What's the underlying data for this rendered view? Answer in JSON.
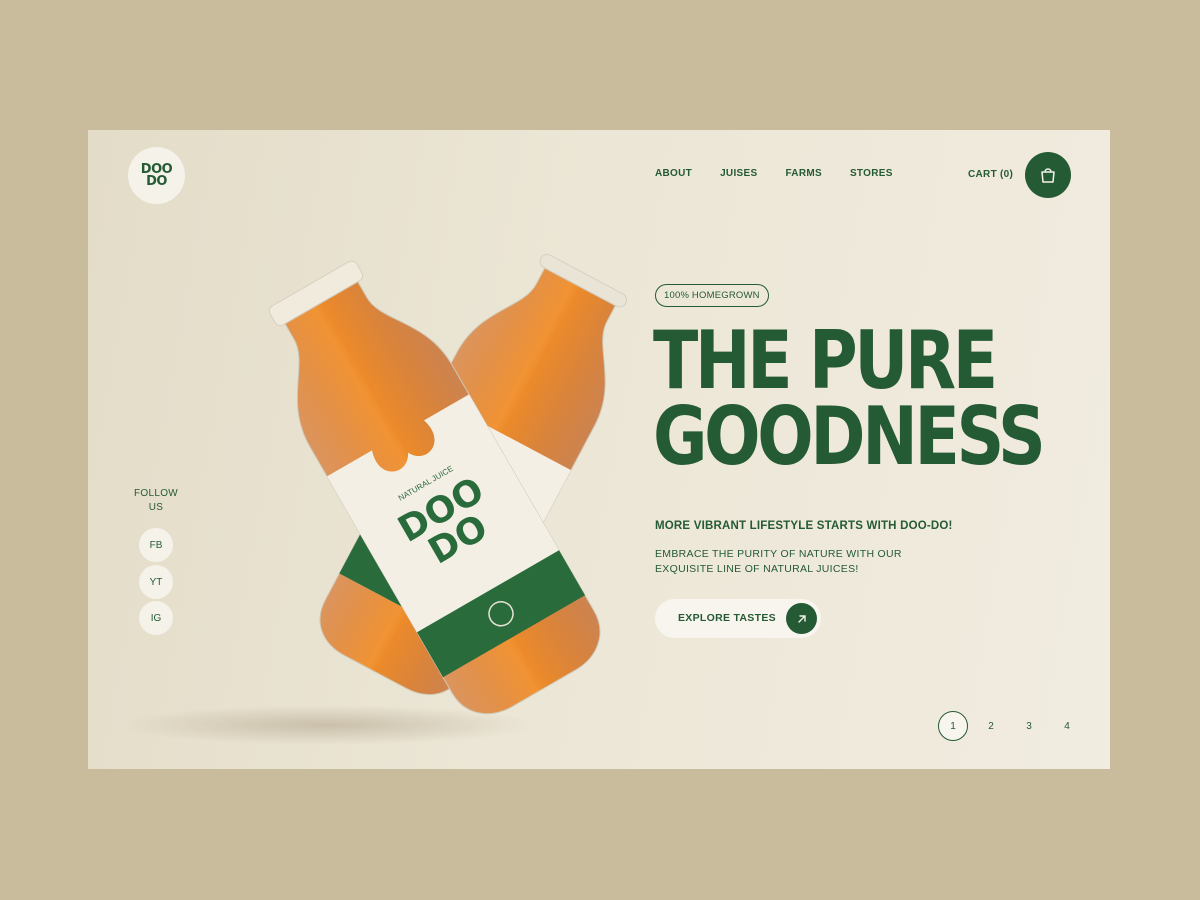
{
  "brand": {
    "logo_line1": "DOO",
    "logo_line2": "DO"
  },
  "nav": {
    "items": [
      {
        "label": "ABOUT"
      },
      {
        "label": "JUISES"
      },
      {
        "label": "FARMS"
      },
      {
        "label": "STORES"
      }
    ]
  },
  "cart": {
    "label": "CART (0)",
    "icon": "shopping-bag-icon"
  },
  "social": {
    "title": "FOLLOW US",
    "links": [
      {
        "label": "FB"
      },
      {
        "label": "YT"
      },
      {
        "label": "IG"
      }
    ]
  },
  "hero": {
    "badge": "100% HOMEGROWN",
    "headline_line1": "THE PURE",
    "headline_line2": "GOODNESS",
    "tagline": "MORE VIBRANT LIFESTYLE STARTS WITH DOO-DO!",
    "description": "EMBRACE THE PURITY OF NATURE WITH OUR EXQUISITE LINE OF NATURAL JUICES!",
    "cta_label": "EXPLORE TASTES",
    "cta_icon": "arrow-up-right-icon"
  },
  "product_label": {
    "subtitle": "NATURAL JUICE",
    "brand_line1": "DOO",
    "brand_line2": "DO"
  },
  "pagination": {
    "pages": [
      "1",
      "2",
      "3",
      "4"
    ],
    "active": "1"
  },
  "colors": {
    "brand_green": "#245a34",
    "juice": "#e07a12",
    "background": "#c8bc9c",
    "panel": "#ece6d6"
  }
}
